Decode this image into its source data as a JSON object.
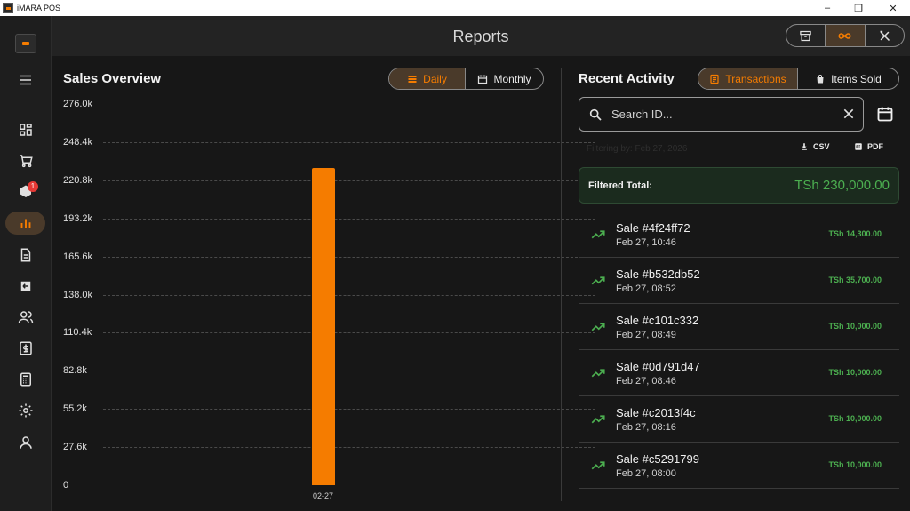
{
  "window": {
    "title": "iMARA POS",
    "minimize": "–",
    "restore": "❐",
    "close": "✕"
  },
  "header": {
    "title": "Reports"
  },
  "sidebar": {
    "items": [
      {
        "name": "menu-icon"
      },
      {
        "name": "dashboard-icon"
      },
      {
        "name": "cart-icon"
      },
      {
        "name": "inventory-icon",
        "badge": "1"
      },
      {
        "name": "reports-icon",
        "active": true
      },
      {
        "name": "document-icon"
      },
      {
        "name": "returns-icon"
      },
      {
        "name": "users-icon"
      },
      {
        "name": "cash-icon"
      },
      {
        "name": "calculator-icon"
      },
      {
        "name": "settings-icon"
      },
      {
        "name": "profile-icon"
      }
    ]
  },
  "sales_overview": {
    "title": "Sales Overview",
    "toggle": {
      "daily": "Daily",
      "monthly": "Monthly",
      "selected": "Daily"
    }
  },
  "chart_data": {
    "type": "bar",
    "categories": [
      "02-27"
    ],
    "values": [
      230000
    ],
    "ylim": [
      0,
      276000
    ],
    "yticks": [
      "0",
      "27.6k",
      "55.2k",
      "82.8k",
      "110.4k",
      "138.0k",
      "165.6k",
      "193.2k",
      "220.8k",
      "248.4k",
      "276.0k"
    ],
    "grid": true,
    "color": "#f57c00"
  },
  "recent_activity": {
    "title": "Recent Activity",
    "toggle": {
      "transactions": "Transactions",
      "items_sold": "Items Sold",
      "selected": "Transactions"
    },
    "search": {
      "placeholder": "Search ID...",
      "value": ""
    },
    "filter_note": "Filtering by: Feb 27, 2026",
    "export": {
      "csv": "CSV",
      "pdf": "PDF"
    },
    "filtered_total_label": "Filtered Total:",
    "filtered_total_value": "TSh 230,000.00",
    "transactions": [
      {
        "title": "Sale #4f24ff72",
        "date": "Feb 27, 10:46",
        "amount": "TSh 14,300.00"
      },
      {
        "title": "Sale #b532db52",
        "date": "Feb 27, 08:52",
        "amount": "TSh 35,700.00"
      },
      {
        "title": "Sale #c101c332",
        "date": "Feb 27, 08:49",
        "amount": "TSh 10,000.00"
      },
      {
        "title": "Sale #0d791d47",
        "date": "Feb 27, 08:46",
        "amount": "TSh 10,000.00"
      },
      {
        "title": "Sale #c2013f4c",
        "date": "Feb 27, 08:16",
        "amount": "TSh 10,000.00"
      },
      {
        "title": "Sale #c5291799",
        "date": "Feb 27, 08:00",
        "amount": "TSh 10,000.00"
      }
    ]
  },
  "colors": {
    "accent": "#f57c00",
    "positive": "#4caf50",
    "background": "#171717"
  }
}
